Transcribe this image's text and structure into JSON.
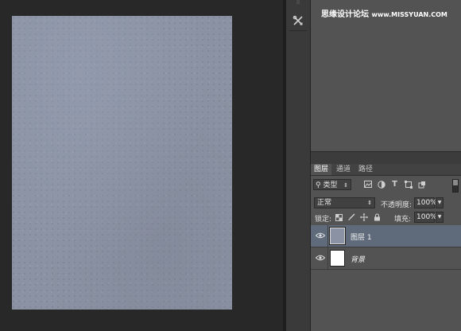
{
  "watermark": {
    "text": "思缘设计论坛",
    "url": "www.MISSYUAN.COM"
  },
  "colors": {
    "document_texture": "#8a92a3",
    "selected_layer": "#5f6b7b",
    "panel": "#535353",
    "workspace": "#282828"
  },
  "layers_panel": {
    "tabs": [
      "图层",
      "通道",
      "路径"
    ],
    "kind_filter": {
      "label": "类型"
    },
    "blend_mode": "正常",
    "opacity_label": "不透明度:",
    "opacity_value": "100%",
    "lock_label": "锁定:",
    "fill_label": "填充:",
    "fill_value": "100%",
    "layers": [
      {
        "name": "图层 1",
        "selected": true,
        "thumbnail": "texture"
      },
      {
        "name": "背景",
        "selected": false,
        "thumbnail": "white",
        "italic": true
      }
    ]
  }
}
